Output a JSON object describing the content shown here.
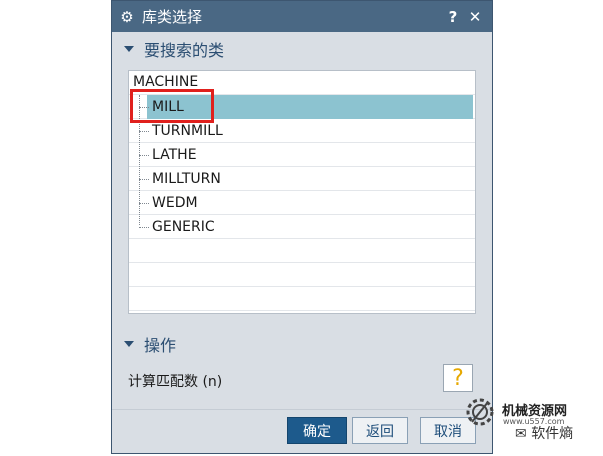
{
  "window": {
    "title": "库类选择",
    "help_label": "?",
    "close_label": "✕"
  },
  "search_section": {
    "title": "要搜索的类",
    "tree": {
      "root": "MACHINE",
      "children": [
        "MILL",
        "TURNMILL",
        "LATHE",
        "MILLTURN",
        "WEDM",
        "GENERIC"
      ],
      "selected": "MILL"
    }
  },
  "operations_section": {
    "title": "操作",
    "match_count_label": "计算匹配数 (n)",
    "help_icon": "?"
  },
  "buttons": {
    "ok": "确定",
    "back": "返回",
    "cancel": "取消"
  },
  "watermark": {
    "brand": "机械资源网",
    "url": "www.u557.com",
    "source": "软件熵"
  },
  "colors": {
    "titlebar": "#4a6884",
    "selection": "#8cc3d0",
    "highlight_box": "#e0201d",
    "primary_button": "#1d5a8c",
    "section_title": "#2b4e72"
  }
}
